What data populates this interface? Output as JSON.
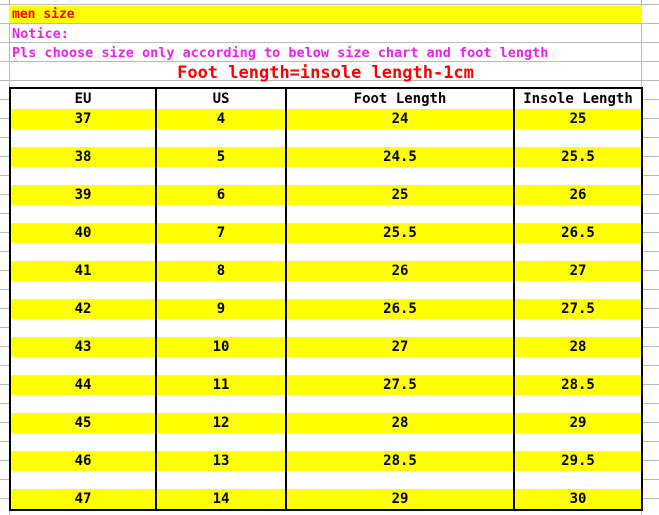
{
  "title": {
    "text": "men size",
    "text_color": "#ff0000",
    "highlight_color": "#ffff00"
  },
  "notice": {
    "label": "Notice:",
    "body": "Pls choose size only according to below size chart and foot length",
    "color": "#f020f0"
  },
  "formula": {
    "text": "Foot length=insole length-1cm",
    "color": "#ff0000"
  },
  "table": {
    "columns": [
      "EU",
      "US",
      "Foot Length",
      "Insole Length"
    ],
    "row_highlight_color": "#ffff00",
    "border_color": "#000000",
    "rows": [
      [
        "37",
        "4",
        "24",
        "25"
      ],
      [
        "38",
        "5",
        "24.5",
        "25.5"
      ],
      [
        "39",
        "6",
        "25",
        "26"
      ],
      [
        "40",
        "7",
        "25.5",
        "26.5"
      ],
      [
        "41",
        "8",
        "26",
        "27"
      ],
      [
        "42",
        "9",
        "26.5",
        "27.5"
      ],
      [
        "43",
        "10",
        "27",
        "28"
      ],
      [
        "44",
        "11",
        "27.5",
        "28.5"
      ],
      [
        "45",
        "12",
        "28",
        "29"
      ],
      [
        "46",
        "13",
        "28.5",
        "29.5"
      ],
      [
        "47",
        "14",
        "29",
        "30"
      ]
    ]
  }
}
